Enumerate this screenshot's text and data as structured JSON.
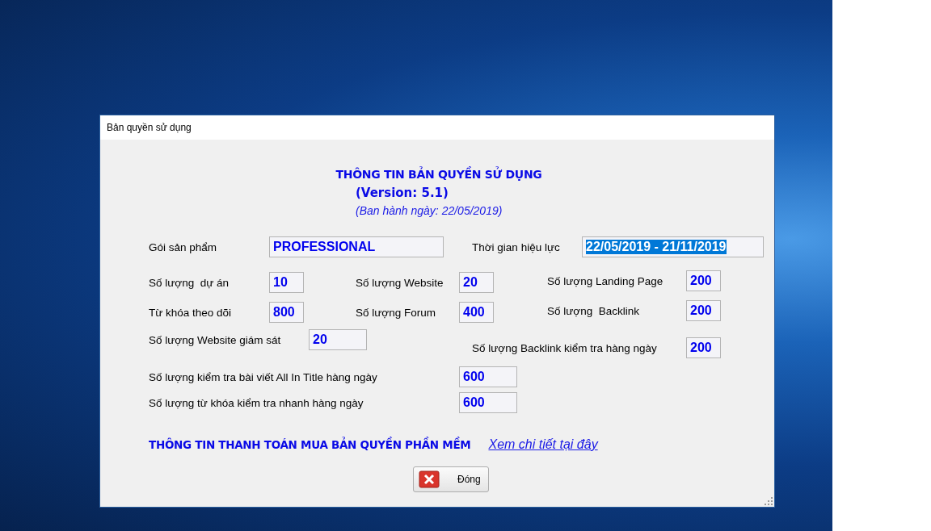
{
  "window": {
    "title": "Bản quyền sử dụng"
  },
  "header": {
    "title": "THÔNG TIN BẢN QUYỀN SỬ DỤNG",
    "version": "(Version: 5.1)",
    "issued": "(Ban hành ngày: 22/05/2019)"
  },
  "rows": [
    [
      {
        "label": "Gói sản phẩm",
        "value": "PROFESSIONAL",
        "selected": false
      },
      {
        "label": "Thời gian hiệu lực",
        "value": "22/05/2019 - 21/11/2019",
        "selected": true
      }
    ],
    [
      {
        "label": "Số lượng  dự án",
        "value": "10",
        "selected": false
      },
      {
        "label": "Số lượng Website",
        "value": "20",
        "selected": false
      },
      {
        "label": "Số lượng Landing Page",
        "value": "200",
        "selected": false
      }
    ],
    [
      {
        "label": "Từ khóa theo dõi",
        "value": "800",
        "selected": false
      },
      {
        "label": "Số lượng Forum",
        "value": "400",
        "selected": false
      },
      {
        "label": "Số lượng  Backlink",
        "value": "200",
        "selected": false
      }
    ],
    [
      {
        "label": "Số lượng Website giám sát",
        "value": "20",
        "selected": false
      },
      {
        "label": "Số lượng Backlink kiểm tra hàng ngày",
        "value": "200",
        "selected": false
      }
    ],
    [
      {
        "label": "Số lượng kiểm tra bài viết All In Title hàng ngày",
        "value": "600",
        "selected": false
      }
    ],
    [
      {
        "label": "Số lượng từ khóa kiểm tra nhanh hàng ngày",
        "value": "600",
        "selected": false
      }
    ]
  ],
  "payment": {
    "label": "THÔNG TIN THANH TOÁN MUA BẢN QUYỀN PHẦN MỀM",
    "link": "Xem chi tiết tại đây"
  },
  "buttons": [
    {
      "label": "Đóng"
    }
  ]
}
